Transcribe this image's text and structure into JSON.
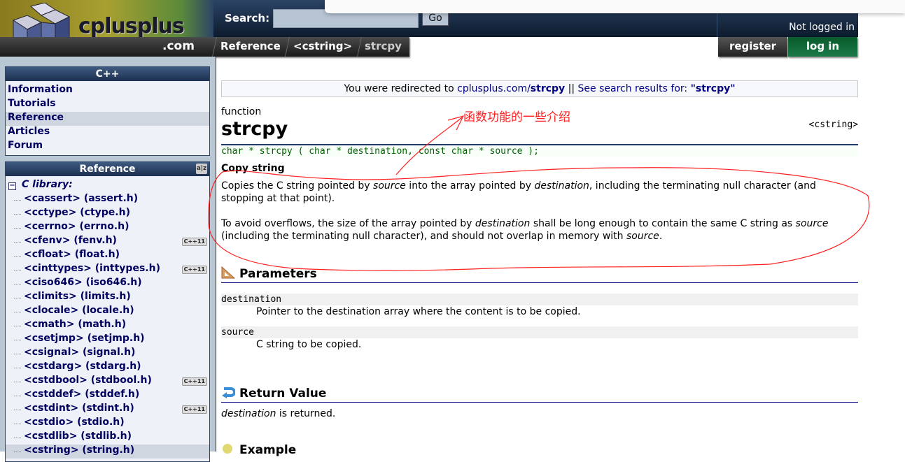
{
  "header": {
    "logo_text": "cplusplus",
    "logo_com": ".com",
    "search_label": "Search:",
    "search_value": "",
    "go_label": "Go",
    "login_status": "Not logged in",
    "register_label": "register",
    "login_label": "log in"
  },
  "breadcrumb": [
    "Reference",
    "<cstring>",
    "strcpy"
  ],
  "sidebar": {
    "cpp_box": {
      "title": "C++",
      "items": [
        "Information",
        "Tutorials",
        "Reference",
        "Articles",
        "Forum"
      ],
      "selected": "Reference"
    },
    "ref_box": {
      "title": "Reference",
      "group": "C library:",
      "items": [
        {
          "label": "<cassert> (assert.h)"
        },
        {
          "label": "<cctype> (ctype.h)"
        },
        {
          "label": "<cerrno> (errno.h)"
        },
        {
          "label": "<cfenv> (fenv.h)",
          "badge": "C++11"
        },
        {
          "label": "<cfloat> (float.h)"
        },
        {
          "label": "<cinttypes> (inttypes.h)",
          "badge": "C++11"
        },
        {
          "label": "<ciso646> (iso646.h)"
        },
        {
          "label": "<climits> (limits.h)"
        },
        {
          "label": "<clocale> (locale.h)"
        },
        {
          "label": "<cmath> (math.h)"
        },
        {
          "label": "<csetjmp> (setjmp.h)"
        },
        {
          "label": "<csignal> (signal.h)"
        },
        {
          "label": "<cstdarg> (stdarg.h)"
        },
        {
          "label": "<cstdbool> (stdbool.h)",
          "badge": "C++11"
        },
        {
          "label": "<cstddef> (stddef.h)"
        },
        {
          "label": "<cstdint> (stdint.h)",
          "badge": "C++11"
        },
        {
          "label": "<cstdio> (stdio.h)"
        },
        {
          "label": "<cstdlib> (stdlib.h)"
        },
        {
          "label": "<cstring> (string.h)",
          "selected": true
        }
      ]
    }
  },
  "main": {
    "redirect": {
      "prefix": "You were redirected to ",
      "link_host": "cplusplus.com/",
      "link_page": "strcpy",
      "sep": " || ",
      "search_text": "See search results for: ",
      "search_term": "\"strcpy\""
    },
    "kind": "function",
    "title": "strcpy",
    "header_name": "<cstring>",
    "prototype": "char * strcpy ( char * destination, const char * source );",
    "subtitle": "Copy string",
    "p1": [
      "Copies the C string pointed by ",
      "source",
      " into the array pointed by ",
      "destination",
      ", including the terminating null character (and stopping at that point)."
    ],
    "p2": [
      "To avoid overflows, the size of the array pointed by ",
      "destination",
      " shall be long enough to contain the same C string as ",
      "source",
      " (including the terminating null character), and should not overlap in memory with ",
      "source",
      "."
    ],
    "parameters_title": "Parameters",
    "params": [
      {
        "name": "destination",
        "desc": "Pointer to the destination array where the content is to be copied."
      },
      {
        "name": "source",
        "desc": "C string to be copied."
      }
    ],
    "return_title": "Return Value",
    "return_text": [
      "destination",
      " is returned."
    ],
    "example_title": "Example"
  },
  "annotation": {
    "text": "函数功能的一些介绍",
    "color": "#ff2020"
  }
}
